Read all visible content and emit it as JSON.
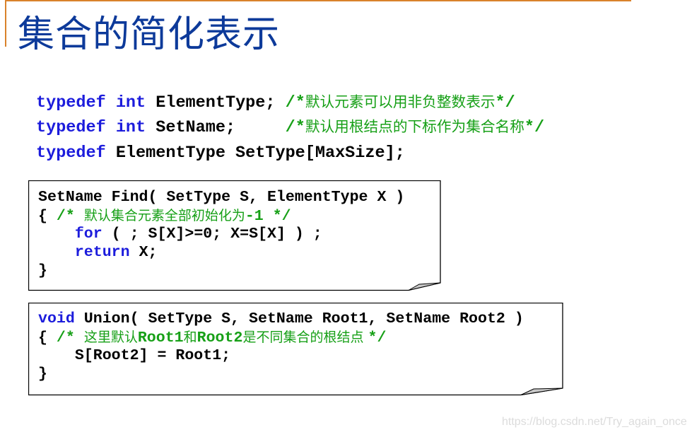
{
  "title": "集合的简化表示",
  "typedefs": [
    [
      {
        "t": "typedef ",
        "c": "kw"
      },
      {
        "t": "int ",
        "c": "kw"
      },
      {
        "t": "ElementType; ",
        "c": "tx"
      },
      {
        "t": "/*",
        "c": "cm"
      },
      {
        "t": "默认元素可以用非负整数表示",
        "c": "cn"
      },
      {
        "t": "*/",
        "c": "cm"
      }
    ],
    [
      {
        "t": "typedef ",
        "c": "kw"
      },
      {
        "t": "int ",
        "c": "kw"
      },
      {
        "t": "SetName;     ",
        "c": "tx"
      },
      {
        "t": "/*",
        "c": "cm"
      },
      {
        "t": "默认用根结点的下标作为集合名称",
        "c": "cn"
      },
      {
        "t": "*/",
        "c": "cm"
      }
    ],
    [
      {
        "t": "typedef ",
        "c": "kw"
      },
      {
        "t": "ElementType SetType[MaxSize];",
        "c": "tx"
      }
    ]
  ],
  "find_box": [
    [
      {
        "t": "SetName Find( SetType S, ElementType X )",
        "c": "tx"
      }
    ],
    [
      {
        "t": "{ ",
        "c": "tx"
      },
      {
        "t": "/* ",
        "c": "cm"
      },
      {
        "t": "默认集合元素全部初始化为",
        "c": "cn"
      },
      {
        "t": "-1 */",
        "c": "cm"
      }
    ],
    [
      {
        "t": "    ",
        "c": "tx"
      },
      {
        "t": "for",
        "c": "kw"
      },
      {
        "t": " ( ; S[X]>=0; X=S[X] ) ;",
        "c": "tx"
      }
    ],
    [
      {
        "t": "    ",
        "c": "tx"
      },
      {
        "t": "return",
        "c": "kw"
      },
      {
        "t": " X;",
        "c": "tx"
      }
    ],
    [
      {
        "t": "}",
        "c": "tx"
      }
    ]
  ],
  "union_box": [
    [
      {
        "t": "void",
        "c": "kw"
      },
      {
        "t": " Union( SetType S, SetName Root1, SetName Root2 )",
        "c": "tx"
      }
    ],
    [
      {
        "t": "{ ",
        "c": "tx"
      },
      {
        "t": "/* ",
        "c": "cm"
      },
      {
        "t": "这里默认",
        "c": "cn"
      },
      {
        "t": "Root1",
        "c": "cm"
      },
      {
        "t": "和",
        "c": "cn"
      },
      {
        "t": "Root2",
        "c": "cm"
      },
      {
        "t": "是不同集合的根结点 ",
        "c": "cn"
      },
      {
        "t": "*/",
        "c": "cm"
      }
    ],
    [
      {
        "t": "    S[Root2] = Root1;",
        "c": "tx"
      }
    ],
    [
      {
        "t": "}",
        "c": "tx"
      }
    ]
  ],
  "watermark": "https://blog.csdn.net/Try_again_once",
  "colors": {
    "title": "#0d3a9a",
    "keyword": "#1c1cdc",
    "comment": "#17a017",
    "frame": "#d9822b"
  }
}
